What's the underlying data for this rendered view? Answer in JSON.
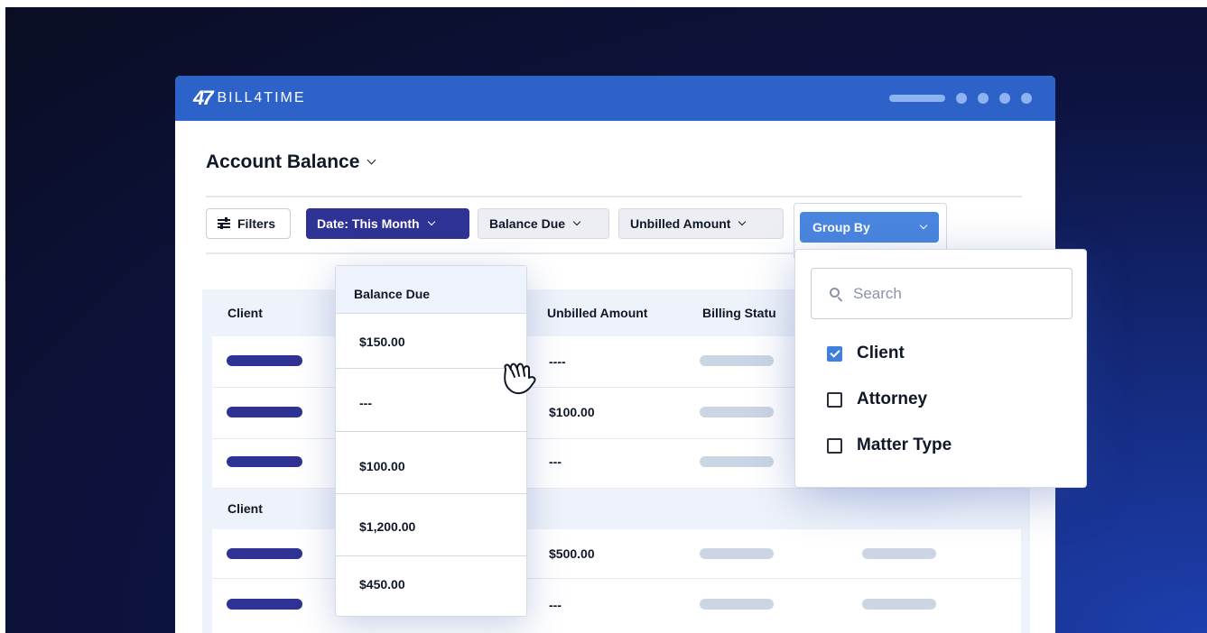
{
  "app": {
    "logo_mark": "47",
    "name": "BILL4TIME"
  },
  "page": {
    "title": "Account Balance"
  },
  "filters": {
    "filters_label": "Filters",
    "date_label": "Date: This Month",
    "balance_label": "Balance Due",
    "unbilled_label": "Unbilled Amount",
    "group_by_label": "Group By"
  },
  "table": {
    "headers": {
      "client": "Client",
      "unbilled": "Unbilled Amount",
      "billing_status": "Billing Statu"
    },
    "group_label": "Client",
    "unbilled_values": [
      "----",
      "$100.00",
      "---",
      "$500.00",
      "---"
    ]
  },
  "balance_popup": {
    "title": "Balance Due",
    "values": [
      "$150.00",
      "---",
      "$100.00",
      "$1,200.00",
      "$450.00"
    ]
  },
  "group_popup": {
    "search_placeholder": "Search",
    "options": [
      {
        "label": "Client",
        "checked": true
      },
      {
        "label": "Attorney",
        "checked": false
      },
      {
        "label": "Matter Type",
        "checked": false
      }
    ]
  },
  "colors": {
    "titlebar": "#2d63c8",
    "accent_dark": "#2f3295",
    "accent_blue": "#4a86e0"
  },
  "icons": [
    "sliders-icon",
    "chevron-down-icon",
    "search-icon",
    "hand-cursor-icon",
    "checkbox-icon"
  ]
}
